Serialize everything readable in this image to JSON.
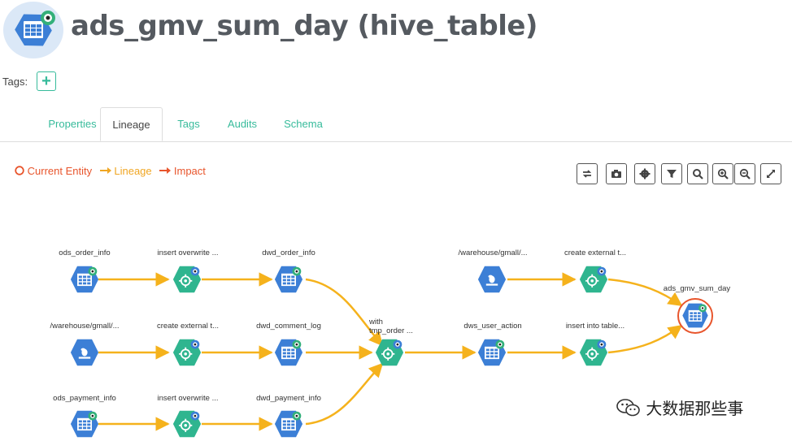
{
  "header": {
    "title": "ads_gmv_sum_day (hive_table)",
    "icon": "hive-table-icon"
  },
  "tags": {
    "label": "Tags:",
    "add_label": "+"
  },
  "tabs": [
    {
      "label": "Properties",
      "active": false
    },
    {
      "label": "Lineage",
      "active": true
    },
    {
      "label": "Tags",
      "active": false
    },
    {
      "label": "Audits",
      "active": false
    },
    {
      "label": "Schema",
      "active": false
    }
  ],
  "legend": {
    "current": {
      "label": "Current Entity",
      "color": "#e8552c"
    },
    "lineage": {
      "label": "Lineage",
      "color": "#f0a623"
    },
    "impact": {
      "label": "Impact",
      "color": "#e8552c"
    }
  },
  "toolbar": [
    "refresh-icon",
    "camera-icon",
    "settings-icon",
    "filter-icon",
    "search-icon",
    "zoom-in-icon",
    "zoom-out-icon",
    "fullscreen-icon"
  ],
  "graph": {
    "nodes": [
      {
        "id": "n1",
        "label": "ods_order_info",
        "kind": "table"
      },
      {
        "id": "n2",
        "label": "insert overwrite ...",
        "kind": "process"
      },
      {
        "id": "n3",
        "label": "dwd_order_info",
        "kind": "table"
      },
      {
        "id": "n4",
        "label": "/warehouse/gmall/...",
        "kind": "hdfs"
      },
      {
        "id": "n5",
        "label": "create external t...",
        "kind": "process"
      },
      {
        "id": "n6",
        "label": "dwd_comment_log",
        "kind": "table"
      },
      {
        "id": "n7",
        "label": "ods_payment_info",
        "kind": "table"
      },
      {
        "id": "n8",
        "label": "insert overwrite ...",
        "kind": "process"
      },
      {
        "id": "n9",
        "label": "dwd_payment_info",
        "kind": "table"
      },
      {
        "id": "n10",
        "label": "with",
        "label2": "tmp_order ...",
        "kind": "process"
      },
      {
        "id": "n11",
        "label": "/warehouse/gmall/...",
        "kind": "hdfs"
      },
      {
        "id": "n12",
        "label": "create external t...",
        "kind": "process"
      },
      {
        "id": "n13",
        "label": "dws_user_action",
        "kind": "table"
      },
      {
        "id": "n14",
        "label": "insert into table...",
        "kind": "process"
      },
      {
        "id": "n15",
        "label": "ads_gmv_sum_day",
        "kind": "table",
        "current": true
      }
    ],
    "colors": {
      "table": "#3c7fd6",
      "process": "#2fb58f",
      "hdfs": "#3c7fd6",
      "edge": "#f5b21c",
      "badge": "#33b07a"
    }
  },
  "watermark": "大数据那些事"
}
